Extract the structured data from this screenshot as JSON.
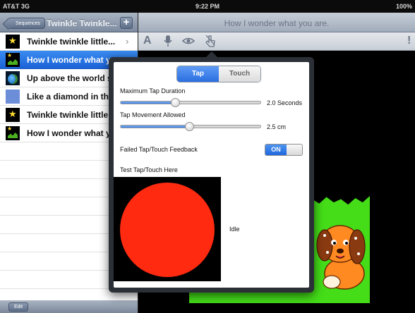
{
  "status_bar": {
    "carrier": "AT&T 3G",
    "time": "9:22 PM",
    "battery": "100%"
  },
  "left_nav": {
    "back_label": "Sequences",
    "title": "Twinkle Twinkle...",
    "add_label": "+"
  },
  "right_nav": {
    "title": "How I wonder what you are."
  },
  "list": {
    "items": [
      {
        "label": "Twinkle twinkle little...",
        "thumb": "star"
      },
      {
        "label": "How I wonder what y",
        "thumb": "grass",
        "selected": true
      },
      {
        "label": "Up above the world s",
        "thumb": "globe"
      },
      {
        "label": "Like a diamond in th",
        "thumb": "blue"
      },
      {
        "label": "Twinkle twinkle little",
        "thumb": "star"
      },
      {
        "label": "How I wonder what y",
        "thumb": "grass"
      }
    ]
  },
  "left_toolbar": {
    "edit_label": "Edit"
  },
  "icon_toolbar": {
    "icons": [
      "text-icon",
      "microphone-icon",
      "eye-icon",
      "touch-icon"
    ],
    "alert": "!"
  },
  "popover": {
    "tabs": [
      "Tap",
      "Touch"
    ],
    "selected_tab": "Tap",
    "max_tap_label": "Maximum Tap Duration",
    "max_tap_value": "2.0 Seconds",
    "max_tap_fraction": 0.39,
    "movement_label": "Tap Movement Allowed",
    "movement_value": "2.5 cm",
    "movement_fraction": 0.49,
    "feedback_label": "Failed Tap/Touch Feedback",
    "feedback_state": "ON",
    "test_label": "Test Tap/Touch Here",
    "test_status": "Idle"
  },
  "colors": {
    "accent": "#2a6ee0",
    "circle": "#ff2a10",
    "grass": "#44dd18"
  }
}
